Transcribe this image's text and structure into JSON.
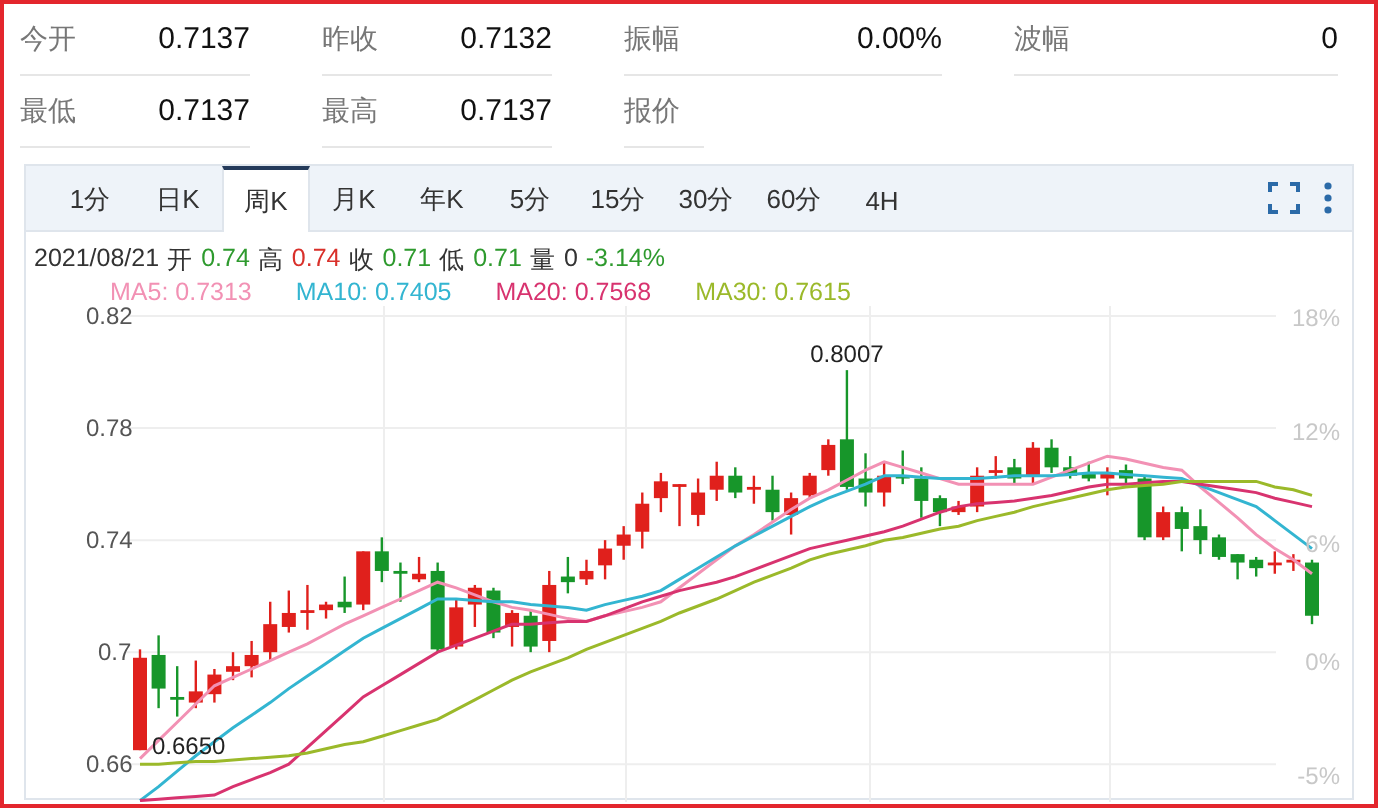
{
  "stats": [
    {
      "label": "今开",
      "value": "0.7137"
    },
    {
      "label": "昨收",
      "value": "0.7132"
    },
    {
      "label": "振幅",
      "value": "0.00%"
    },
    {
      "label": "波幅",
      "value": "0"
    },
    {
      "label": "最低",
      "value": "0.7137"
    },
    {
      "label": "最高",
      "value": "0.7137"
    },
    {
      "label": "报价"
    }
  ],
  "chart": {
    "tabs": [
      {
        "label": "1分",
        "selected": false
      },
      {
        "label": "日K",
        "selected": false
      },
      {
        "label": "周K",
        "selected": true
      },
      {
        "label": "月K",
        "selected": false
      },
      {
        "label": "年K",
        "selected": false
      },
      {
        "label": "5分",
        "selected": false
      },
      {
        "label": "15分",
        "selected": false
      },
      {
        "label": "30分",
        "selected": false
      },
      {
        "label": "60分",
        "selected": false
      },
      {
        "label": "4H",
        "selected": false
      }
    ],
    "quote": {
      "date": "2021/08/21",
      "items": [
        {
          "label": "开",
          "value": "0.74",
          "color": "#2e9a2e"
        },
        {
          "label": "高",
          "value": "0.74",
          "color": "#d9302a"
        },
        {
          "label": "收",
          "value": "0.71",
          "color": "#2e9a2e"
        },
        {
          "label": "低",
          "value": "0.71",
          "color": "#2e9a2e"
        },
        {
          "label": "量",
          "value": "0",
          "color": "#333333"
        },
        {
          "value": "-3.14%",
          "color": "#2e9a2e"
        }
      ]
    },
    "right_axis_labels": [
      "18%",
      "12%",
      "6%",
      "0%",
      "-5%"
    ],
    "chart_data": {
      "type": "candlestick",
      "grid": true,
      "ylim": [
        0.6465,
        0.8236
      ],
      "yticks": [
        {
          "value": 0.82,
          "label": "0.82"
        },
        {
          "value": 0.78,
          "label": "0.78"
        },
        {
          "value": 0.74,
          "label": "0.74"
        },
        {
          "value": 0.7,
          "label": "0.7"
        },
        {
          "value": 0.66,
          "label": "0.66"
        }
      ],
      "ohlc": [
        [
          0.665,
          0.701,
          0.665,
          0.698
        ],
        [
          0.699,
          0.706,
          0.68,
          0.687
        ],
        [
          0.684,
          0.695,
          0.677,
          0.683
        ],
        [
          0.682,
          0.697,
          0.68,
          0.686
        ],
        [
          0.685,
          0.694,
          0.682,
          0.692
        ],
        [
          0.693,
          0.7,
          0.69,
          0.695
        ],
        [
          0.695,
          0.704,
          0.691,
          0.699
        ],
        [
          0.7,
          0.718,
          0.697,
          0.71
        ],
        [
          0.709,
          0.722,
          0.707,
          0.714
        ],
        [
          0.714,
          0.724,
          0.708,
          0.715
        ],
        [
          0.715,
          0.718,
          0.712,
          0.717
        ],
        [
          0.718,
          0.727,
          0.714,
          0.716
        ],
        [
          0.717,
          0.736,
          0.715,
          0.736
        ],
        [
          0.736,
          0.741,
          0.725,
          0.729
        ],
        [
          0.729,
          0.732,
          0.718,
          0.728
        ],
        [
          0.726,
          0.734,
          0.725,
          0.728
        ],
        [
          0.729,
          0.732,
          0.7,
          0.701
        ],
        [
          0.702,
          0.719,
          0.701,
          0.716
        ],
        [
          0.717,
          0.724,
          0.709,
          0.723
        ],
        [
          0.722,
          0.723,
          0.705,
          0.707
        ],
        [
          0.709,
          0.715,
          0.702,
          0.714
        ],
        [
          0.713,
          0.715,
          0.7,
          0.702
        ],
        [
          0.704,
          0.729,
          0.7,
          0.724
        ],
        [
          0.727,
          0.734,
          0.721,
          0.725
        ],
        [
          0.726,
          0.733,
          0.724,
          0.729
        ],
        [
          0.731,
          0.74,
          0.726,
          0.737
        ],
        [
          0.738,
          0.745,
          0.733,
          0.742
        ],
        [
          0.743,
          0.757,
          0.737,
          0.753
        ],
        [
          0.755,
          0.764,
          0.75,
          0.761
        ],
        [
          0.759,
          0.76,
          0.745,
          0.76
        ],
        [
          0.749,
          0.762,
          0.745,
          0.757
        ],
        [
          0.758,
          0.768,
          0.754,
          0.763
        ],
        [
          0.763,
          0.766,
          0.755,
          0.757
        ],
        [
          0.758,
          0.763,
          0.753,
          0.759
        ],
        [
          0.758,
          0.763,
          0.747,
          0.75
        ],
        [
          0.749,
          0.757,
          0.742,
          0.755
        ],
        [
          0.756,
          0.764,
          0.755,
          0.763
        ],
        [
          0.765,
          0.776,
          0.763,
          0.774
        ],
        [
          0.776,
          0.8007,
          0.758,
          0.759
        ],
        [
          0.762,
          0.771,
          0.752,
          0.757
        ],
        [
          0.757,
          0.768,
          0.752,
          0.763
        ],
        [
          0.763,
          0.772,
          0.76,
          0.762
        ],
        [
          0.762,
          0.766,
          0.748,
          0.754
        ],
        [
          0.755,
          0.756,
          0.745,
          0.75
        ],
        [
          0.75,
          0.754,
          0.749,
          0.752
        ],
        [
          0.752,
          0.766,
          0.75,
          0.763
        ],
        [
          0.764,
          0.77,
          0.762,
          0.765
        ],
        [
          0.766,
          0.769,
          0.76,
          0.762
        ],
        [
          0.763,
          0.775,
          0.76,
          0.773
        ],
        [
          0.773,
          0.776,
          0.764,
          0.766
        ],
        [
          0.766,
          0.77,
          0.762,
          0.763
        ],
        [
          0.764,
          0.768,
          0.761,
          0.762
        ],
        [
          0.762,
          0.766,
          0.756,
          0.764
        ],
        [
          0.765,
          0.767,
          0.76,
          0.762
        ],
        [
          0.762,
          0.763,
          0.74,
          0.741
        ],
        [
          0.741,
          0.752,
          0.74,
          0.75
        ],
        [
          0.75,
          0.752,
          0.736,
          0.744
        ],
        [
          0.745,
          0.751,
          0.735,
          0.74
        ],
        [
          0.741,
          0.742,
          0.733,
          0.734
        ],
        [
          0.735,
          0.735,
          0.726,
          0.732
        ],
        [
          0.733,
          0.734,
          0.727,
          0.73
        ],
        [
          0.731,
          0.736,
          0.728,
          0.732
        ],
        [
          0.732,
          0.735,
          0.729,
          0.733
        ],
        [
          0.732,
          0.733,
          0.71,
          0.713
        ]
      ],
      "series": [
        {
          "name": "MA5: 0.7313",
          "type": "line",
          "color": "#f291b4",
          "values": [
            0.662,
            0.6685,
            0.675,
            0.6815,
            0.688,
            0.691,
            0.694,
            0.697,
            0.7,
            0.703,
            0.7065,
            0.71,
            0.713,
            0.716,
            0.719,
            0.722,
            0.725,
            0.723,
            0.7205,
            0.718,
            0.716,
            0.715,
            0.7135,
            0.712,
            0.711,
            0.713,
            0.7145,
            0.716,
            0.718,
            0.723,
            0.728,
            0.733,
            0.738,
            0.742,
            0.7465,
            0.751,
            0.755,
            0.758,
            0.7615,
            0.765,
            0.768,
            0.766,
            0.764,
            0.762,
            0.76,
            0.76,
            0.76,
            0.76,
            0.76,
            0.7625,
            0.765,
            0.7675,
            0.77,
            0.769,
            0.7675,
            0.766,
            0.765,
            0.759,
            0.7535,
            0.748,
            0.742,
            0.737,
            0.733,
            0.728
          ]
        },
        {
          "name": "MA10: 0.7405",
          "type": "line",
          "color": "#33b5d1",
          "values": [
            0.647,
            0.652,
            0.6575,
            0.663,
            0.668,
            0.673,
            0.6775,
            0.682,
            0.687,
            0.6915,
            0.696,
            0.7005,
            0.705,
            0.7085,
            0.712,
            0.7155,
            0.719,
            0.719,
            0.7185,
            0.718,
            0.718,
            0.717,
            0.7165,
            0.716,
            0.715,
            0.717,
            0.7185,
            0.72,
            0.722,
            0.726,
            0.73,
            0.734,
            0.738,
            0.7415,
            0.745,
            0.7485,
            0.752,
            0.755,
            0.7575,
            0.76,
            0.763,
            0.763,
            0.7625,
            0.762,
            0.762,
            0.762,
            0.7625,
            0.763,
            0.763,
            0.763,
            0.7635,
            0.764,
            0.764,
            0.7635,
            0.763,
            0.7625,
            0.762,
            0.7595,
            0.757,
            0.7545,
            0.752,
            0.747,
            0.742,
            0.737
          ]
        },
        {
          "name": "MA20: 0.7568",
          "type": "line",
          "color": "#d8336f",
          "values": [
            0.647,
            0.6475,
            0.648,
            0.6485,
            0.649,
            0.652,
            0.6545,
            0.657,
            0.66,
            0.666,
            0.672,
            0.678,
            0.684,
            0.688,
            0.692,
            0.696,
            0.7,
            0.7025,
            0.705,
            0.7075,
            0.71,
            0.71,
            0.7105,
            0.711,
            0.711,
            0.713,
            0.7155,
            0.718,
            0.72,
            0.722,
            0.7235,
            0.725,
            0.727,
            0.7295,
            0.732,
            0.7345,
            0.737,
            0.7385,
            0.74,
            0.7415,
            0.743,
            0.745,
            0.7475,
            0.75,
            0.752,
            0.753,
            0.7535,
            0.754,
            0.755,
            0.756,
            0.7575,
            0.759,
            0.76,
            0.76,
            0.7605,
            0.761,
            0.761,
            0.76,
            0.759,
            0.758,
            0.757,
            0.755,
            0.7535,
            0.752
          ]
        },
        {
          "name": "MA30: 0.7615",
          "type": "line",
          "color": "#9bb92a",
          "values": [
            0.66,
            0.66,
            0.6605,
            0.661,
            0.661,
            0.6615,
            0.662,
            0.6625,
            0.663,
            0.664,
            0.6655,
            0.667,
            0.668,
            0.67,
            0.672,
            0.674,
            0.676,
            0.6795,
            0.683,
            0.6865,
            0.69,
            0.693,
            0.6955,
            0.698,
            0.701,
            0.7035,
            0.706,
            0.7085,
            0.711,
            0.714,
            0.7165,
            0.719,
            0.722,
            0.725,
            0.7275,
            0.73,
            0.733,
            0.735,
            0.7365,
            0.738,
            0.74,
            0.741,
            0.7425,
            0.744,
            0.745,
            0.747,
            0.7485,
            0.75,
            0.752,
            0.7535,
            0.755,
            0.7565,
            0.758,
            0.759,
            0.7595,
            0.76,
            0.761,
            0.761,
            0.761,
            0.761,
            0.761,
            0.759,
            0.758,
            0.756
          ]
        }
      ],
      "annotations": [
        {
          "text": "0.8007",
          "y": 0.8007
        },
        {
          "text": "0.6650",
          "y": 0.665
        }
      ]
    }
  }
}
